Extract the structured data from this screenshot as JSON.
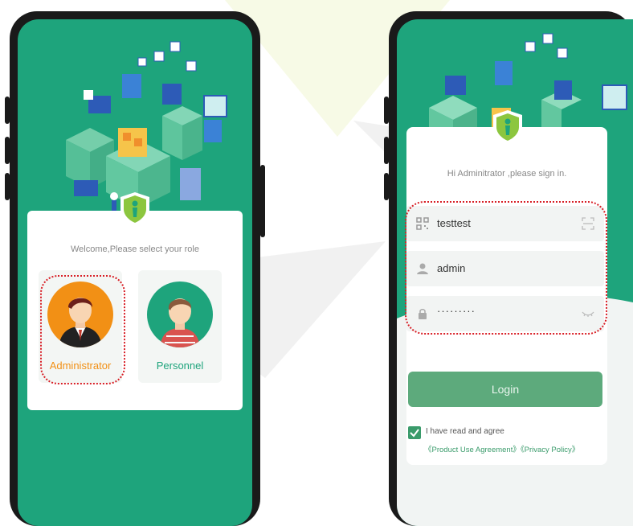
{
  "colors": {
    "brand_green": "#1ea47c",
    "accent_orange": "#f29015",
    "highlight_red": "#d81f26",
    "button_green": "#5daa7c"
  },
  "role_screen": {
    "welcome_text": "Welcome,Please select your role",
    "roles": [
      {
        "label": "Administrator",
        "selected": true
      },
      {
        "label": "Personnel",
        "selected": false
      }
    ]
  },
  "login_screen": {
    "greeting": "Hi Adminitrator ,please sign in.",
    "fields": {
      "tenant": {
        "value": "testtest",
        "icon": "qr-code-icon",
        "right_icon": "scan-icon"
      },
      "username": {
        "value": "admin",
        "icon": "user-icon"
      },
      "password": {
        "value": "·········",
        "icon": "lock-icon",
        "right_icon": "eye-closed-icon"
      }
    },
    "login_button": "Login",
    "agreement": {
      "checked": true,
      "text": "I have read and agree",
      "links": "《Product Use Agreement》《Privacy Policy》"
    }
  }
}
